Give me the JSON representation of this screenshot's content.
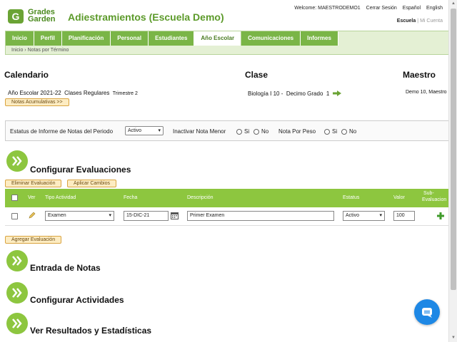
{
  "app": {
    "logo_line1": "Grades",
    "logo_line2": "Garden",
    "title": "Adiestramientos (Escuela Demo)"
  },
  "topbar": {
    "welcome": "Welcome: MAESTRODEMO1",
    "logout": "Cerrar Sesión",
    "lang_es": "Español",
    "lang_en": "English"
  },
  "scope": {
    "school": "Escuela",
    "separator": "|",
    "account": "Mi Cuenta"
  },
  "nav": {
    "tabs": [
      {
        "label": "Inicio"
      },
      {
        "label": "Perfil"
      },
      {
        "label": "Planificación"
      },
      {
        "label": "Personal"
      },
      {
        "label": "Estudiantes"
      },
      {
        "label": "Año Escolar"
      },
      {
        "label": "Comunicaciones"
      },
      {
        "label": "Informes"
      }
    ],
    "active_tab": "Año Escolar",
    "breadcrumb": {
      "home": "Inicio",
      "separator": "›",
      "current": "Notas por Término"
    }
  },
  "calendar": {
    "heading": "Calendario",
    "year": "Año Escolar 2021-22",
    "type": "Clases Regulares",
    "term": "Trimestre 2",
    "button": "Notas Acumulativas >>"
  },
  "class_info": {
    "heading": "Clase",
    "name": "Biología I 10 -",
    "grade": "Decimo Grado",
    "section": "1"
  },
  "teacher": {
    "heading": "Maestro",
    "name": "Demo 10, Maestro"
  },
  "status_bar": {
    "report_label": "Estatus de Informe de Notas del Periodo",
    "report_value": "Activo",
    "inactivate_label": "Inactivar Nota Menor",
    "by_weight_label": "Nota Por Peso",
    "yes": "Si",
    "no": "No"
  },
  "config": {
    "title": "Configurar Evaluaciones",
    "delete_button": "Eliminar Evaluación",
    "apply_button": "Aplicar Cambios",
    "columns": {
      "view": "Ver",
      "type": "Tipo Actividad",
      "date": "Fecha",
      "description": "Descripción",
      "status": "Estatus",
      "value": "Valor",
      "sub_1": "Sub-",
      "sub_2": "Evaluacion"
    },
    "rows": [
      {
        "type": "Examen",
        "date": "15-DIC-21",
        "description": "Primer Examen",
        "status": "Activo",
        "value": "100"
      }
    ],
    "add_button": "Agregar Evaluación"
  },
  "sections": {
    "grades_entry": "Entrada de Notas",
    "activities": "Configurar Actividades",
    "results": "Ver Resultados y Estadísticas"
  },
  "colors": {
    "brand_green": "#8dc63f",
    "tab_green": "#7ab547",
    "title_green": "#5c9a2a",
    "button_bg": "#fdecc2",
    "chat_blue": "#1e88e5"
  }
}
